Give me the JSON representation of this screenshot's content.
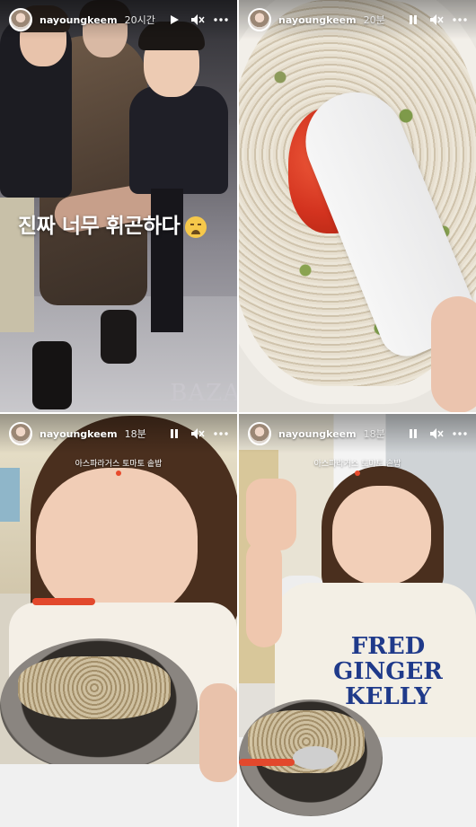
{
  "stories": [
    {
      "username": "nayoungkeem",
      "time": "20시간",
      "caption": "진짜 너무 휘곤하다",
      "brand": "BAZA",
      "controls": [
        "play-icon",
        "mute-icon",
        "more-icon"
      ]
    },
    {
      "username": "nayoungkeem",
      "time": "20분",
      "controls": [
        "pause-icon",
        "mute-icon",
        "more-icon"
      ]
    },
    {
      "username": "nayoungkeem",
      "time": "18분",
      "label": "아스파라거스 토마토 솥밥",
      "controls": [
        "pause-icon",
        "mute-icon",
        "more-icon"
      ]
    },
    {
      "username": "nayoungkeem",
      "time": "18분",
      "label": "아스파라거스 토마토 솥밥",
      "shirt_text": [
        "FRED",
        "GINGER",
        "KELLY"
      ],
      "controls": [
        "pause-icon",
        "mute-icon",
        "more-icon"
      ]
    }
  ],
  "colors": {
    "accent": "#e84a2c",
    "overlay_text": "#ffffff"
  }
}
